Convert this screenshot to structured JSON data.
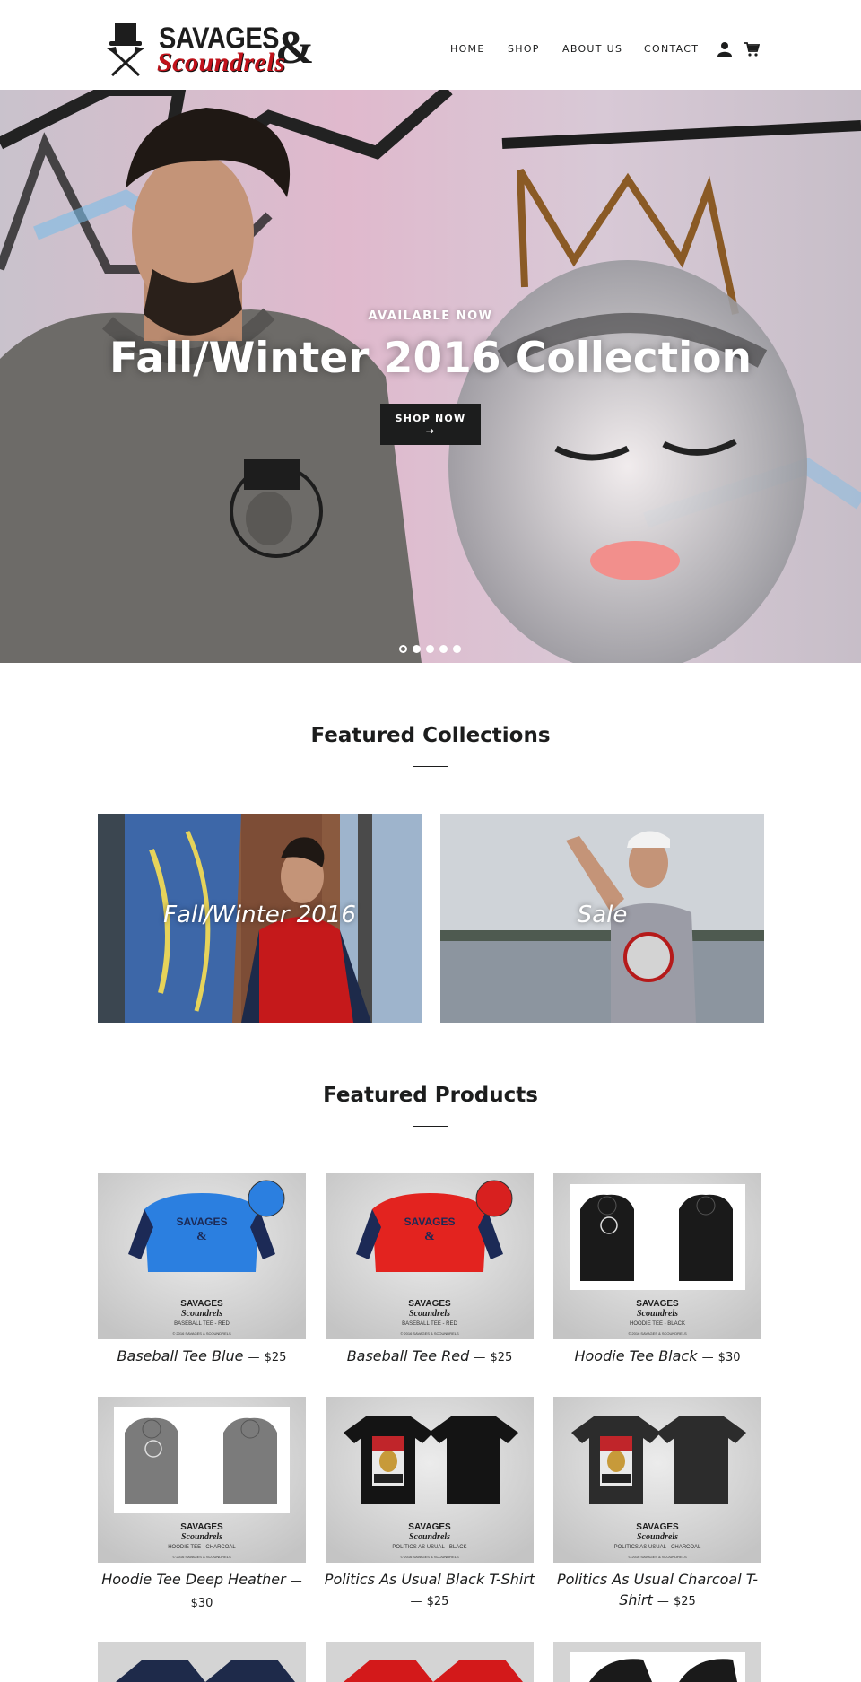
{
  "brand": {
    "line1": "SAVAGES",
    "amp": "&",
    "line2": "Scoundrels"
  },
  "nav": {
    "items": [
      "HOME",
      "SHOP",
      "ABOUT US",
      "CONTACT"
    ],
    "icons": [
      "account-icon",
      "cart-icon"
    ]
  },
  "hero": {
    "kicker": "AVAILABLE NOW",
    "title": "Fall/Winter 2016 Collection",
    "button": "SHOP NOW\n→",
    "slides": 5,
    "active_slide": 1
  },
  "featured_collections": {
    "title": "Featured Collections",
    "items": [
      {
        "label": "Fall/Winter 2016"
      },
      {
        "label": "Sale"
      }
    ]
  },
  "featured_products": {
    "title": "Featured Products",
    "items": [
      {
        "name": "Baseball Tee Blue",
        "price": "$25",
        "dash": "—",
        "shirt": "#2b7fe0",
        "sleeve": "#1c2a56",
        "badge": "#2b7fe0",
        "caption": "BASEBALL TEE - RED"
      },
      {
        "name": "Baseball Tee Red",
        "price": "$25",
        "dash": "—",
        "shirt": "#e3231f",
        "sleeve": "#1c2a56",
        "badge": "#d8201f",
        "caption": "BASEBALL TEE - RED"
      },
      {
        "name": "Hoodie Tee Black",
        "price": "$30",
        "dash": "—",
        "shirt": "#1a1a1a",
        "sleeve": "#1a1a1a",
        "badge": "",
        "caption": "HOODIE TEE - BLACK"
      },
      {
        "name": "Hoodie Tee Deep Heather",
        "price": "$30",
        "dash": "—",
        "shirt": "#7b7b7b",
        "sleeve": "#7b7b7b",
        "badge": "",
        "caption": "HOODIE TEE - CHARCOAL"
      },
      {
        "name": "Politics As Usual Black T-Shirt",
        "price": "$25",
        "dash": "—",
        "shirt": "#141414",
        "sleeve": "#141414",
        "badge": "",
        "caption": "POLITICS AS USUAL - BLACK"
      },
      {
        "name": "Politics As Usual Charcoal T-Shirt",
        "price": "$25",
        "dash": "—",
        "shirt": "#2c2c2c",
        "sleeve": "#2c2c2c",
        "badge": "",
        "caption": "POLITICS AS USUAL - CHARCOAL"
      }
    ],
    "partial_row_colors": [
      "#1e2a4a",
      "#d3191a",
      "#1a1a1a"
    ]
  },
  "copyright_small": "© 2016 SAVAGES & SCOUNDRELS",
  "colors": {
    "text": "#1c1d1d",
    "accent_red": "#c1131b",
    "button": "#1c1d1d",
    "panel": "#cfcfcf"
  }
}
